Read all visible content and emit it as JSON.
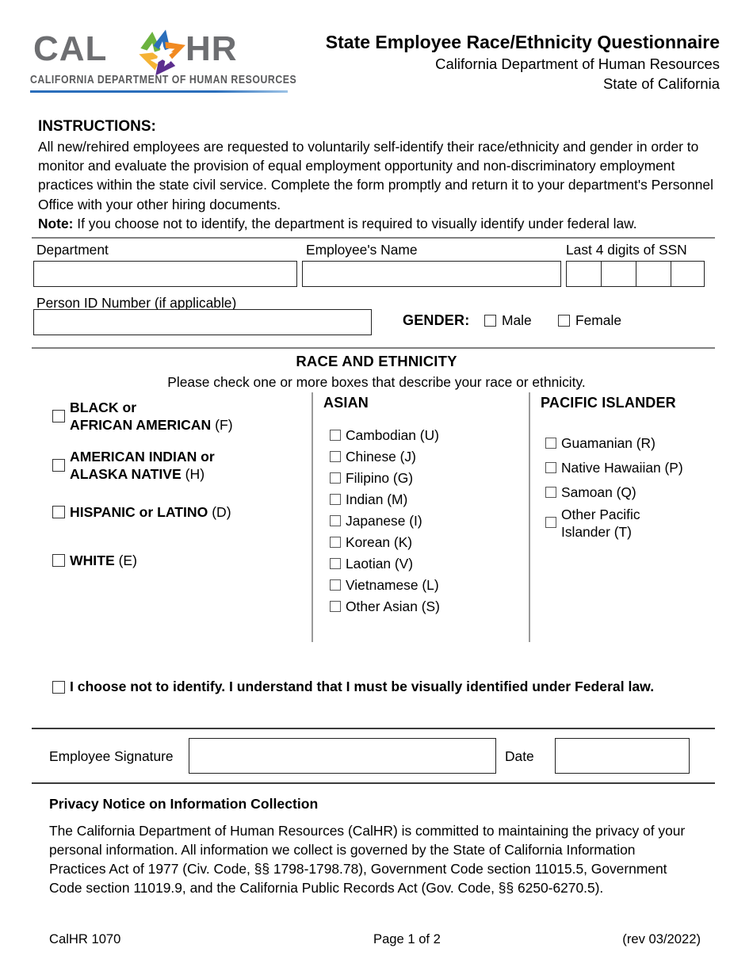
{
  "document": {
    "form_number": "CalHR 1070",
    "page_indicator": "Page 1 of 2",
    "revision": "(rev 03/2022)"
  },
  "logo": {
    "word_cal": "CAL",
    "word_hr": "HR",
    "tagline": "CALIFORNIA DEPARTMENT OF HUMAN RESOURCES",
    "colors": {
      "wordmark_gray": "#6d6e71",
      "rule_blue": "#2a6ebb",
      "star_green": "#6cb33f",
      "star_blue": "#2a6ebb",
      "star_orange": "#f18a21",
      "star_purple": "#5b2d8e",
      "star_yellow": "#f5b335"
    }
  },
  "header": {
    "title": "State Employee Race/Ethnicity Questionnaire",
    "subtitle_1": "California Department of Human Resources",
    "subtitle_2": "State of California"
  },
  "instructions": {
    "heading": "INSTRUCTIONS:",
    "body": "All new/rehired employees are requested to voluntarily self-identify their race/ethnicity and gender in order to monitor and evaluate the provision of equal employment opportunity and non-discriminatory employment practices within the state civil service. Complete the form promptly and return it to your department's Personnel Office with your other hiring documents.",
    "note_label": "Note:",
    "note_text": " If you choose not to identify, the department is required to visually identify under federal law."
  },
  "identity": {
    "department_label": "Department",
    "department_value": "",
    "employee_name_label": "Employee's Name",
    "employee_name_value": "",
    "ssn_label": "Last 4 digits of SSN",
    "ssn_digits": [
      "",
      "",
      "",
      ""
    ],
    "person_id_label": "Person ID Number (if applicable)",
    "person_id_value": "",
    "gender_label": "GENDER:",
    "gender_options": [
      {
        "label": "Male",
        "checked": false
      },
      {
        "label": "Female",
        "checked": false
      }
    ]
  },
  "race_section": {
    "title": "RACE AND ETHNICITY",
    "subtitle": "Please check one or more boxes that describe your race or ethnicity.",
    "left_column": [
      {
        "line1": "BLACK or",
        "line2": "AFRICAN AMERICAN",
        "code": "(F)",
        "checked": false
      },
      {
        "line1": "AMERICAN INDIAN or",
        "line2": "ALASKA NATIVE",
        "code": "(H)",
        "checked": false
      },
      {
        "line1": "HISPANIC or LATINO",
        "line2": "",
        "code": "(D)",
        "checked": false
      },
      {
        "line1": "WHITE",
        "line2": "",
        "code": "(E)",
        "checked": false
      }
    ],
    "asian": {
      "heading": "ASIAN",
      "items": [
        {
          "label": "Cambodian (U)",
          "checked": false
        },
        {
          "label": "Chinese (J)",
          "checked": false
        },
        {
          "label": "Filipino (G)",
          "checked": false
        },
        {
          "label": "Indian (M)",
          "checked": false
        },
        {
          "label": "Japanese (I)",
          "checked": false
        },
        {
          "label": "Korean (K)",
          "checked": false
        },
        {
          "label": "Laotian (V)",
          "checked": false
        },
        {
          "label": "Vietnamese (L)",
          "checked": false
        },
        {
          "label": "Other Asian (S)",
          "checked": false
        }
      ]
    },
    "pacific_islander": {
      "heading": "PACIFIC ISLANDER",
      "items": [
        {
          "label": "Guamanian (R)",
          "line1": "Guamanian (R)",
          "line2": "",
          "checked": false
        },
        {
          "label": "Native Hawaiian (P)",
          "line1": "Native Hawaiian (P)",
          "line2": "",
          "checked": false
        },
        {
          "label": "Samoan (Q)",
          "line1": "Samoan (Q)",
          "line2": "",
          "checked": false
        },
        {
          "label": "Other Pacific Islander (T)",
          "line1": "Other Pacific",
          "line2": "Islander (T)",
          "checked": false
        }
      ]
    },
    "decline": {
      "label": "I choose not to identify.  I understand that I must be visually identified under Federal law.",
      "checked": false
    }
  },
  "signature": {
    "employee_signature_label": "Employee Signature",
    "employee_signature_value": "",
    "date_label": "Date",
    "date_value": ""
  },
  "privacy": {
    "heading": "Privacy Notice on Information Collection",
    "body": "The California Department of Human Resources (CalHR) is committed to maintaining the privacy of your personal information.  All information we collect is governed by the State of California Information Practices Act of 1977 (Civ. Code, §§ 1798-1798.78), Government Code section 11015.5, Government Code section 11019.9, and the California Public Records Act (Gov. Code, §§ 6250-6270.5)."
  }
}
